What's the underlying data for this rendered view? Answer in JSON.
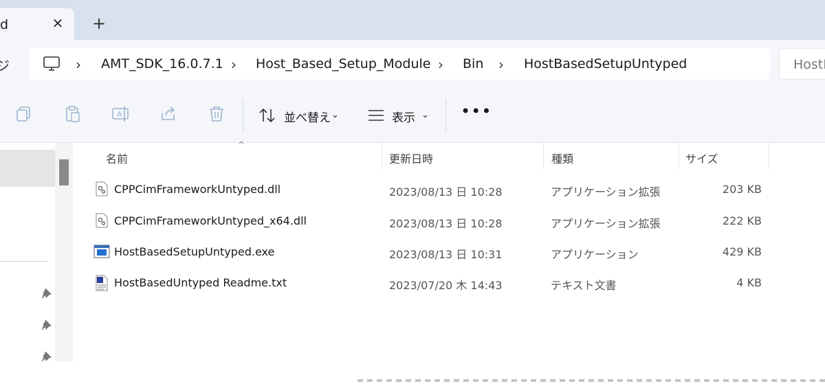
{
  "tab": {
    "title": "d",
    "close_glyph": "✕",
    "new_glyph": "+"
  },
  "nav": {
    "refresh_glyph": "ジ"
  },
  "breadcrumb": {
    "separator": "›",
    "items": [
      "AMT_SDK_16.0.7.1",
      "Host_Based_Setup_Module",
      "Bin",
      "HostBasedSetupUntyped"
    ]
  },
  "search": {
    "placeholder": "HostB"
  },
  "toolbar": {
    "sort_label": "並べ替え",
    "view_label": "表示",
    "more_glyph": "•••",
    "chevron": "⌄"
  },
  "columns": {
    "name": "名前",
    "date": "更新日時",
    "type": "種類",
    "size": "サイズ",
    "sort_caret": "^"
  },
  "files": [
    {
      "name": "CPPCimFrameworkUntyped.dll",
      "date": "2023/08/13 日 10:28",
      "type": "アプリケーション拡張",
      "size": "203 KB",
      "icon": "dll-icon"
    },
    {
      "name": "CPPCimFrameworkUntyped_x64.dll",
      "date": "2023/08/13 日 10:28",
      "type": "アプリケーション拡張",
      "size": "222 KB",
      "icon": "dll-icon"
    },
    {
      "name": "HostBasedSetupUntyped.exe",
      "date": "2023/08/13 日 10:31",
      "type": "アプリケーション",
      "size": "429 KB",
      "icon": "exe-icon"
    },
    {
      "name": "HostBasedUntyped Readme.txt",
      "date": "2023/07/20 木 14:43",
      "type": "テキスト文書",
      "size": "4 KB",
      "icon": "txt-icon"
    }
  ],
  "colors": {
    "titlebar": "#d9e1ee",
    "chrome": "#f4f6fa",
    "accent": "#1e6fd0"
  }
}
